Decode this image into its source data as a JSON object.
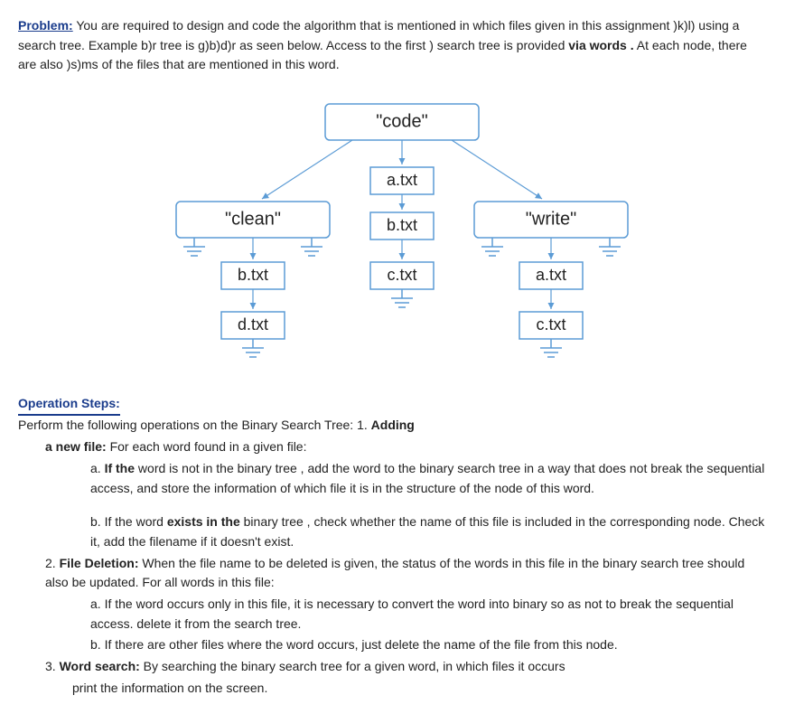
{
  "problem": {
    "heading": "Problem:",
    "text_parts": {
      "p1": " You are required to design and code the algorithm that is mentioned in which files given in this assignment )k)l) using a search tree. Example b)r tree is g)b)d)r as seen below. Access to the first ) search tree is provided ",
      "p2_bold": "via words .",
      "p3": " At each node, there are also )s)ms of the files that are mentioned in this word."
    }
  },
  "tree": {
    "root": "\"code\"",
    "root_files": [
      "a.txt",
      "b.txt",
      "c.txt"
    ],
    "left": "\"clean\"",
    "left_files": [
      "b.txt",
      "d.txt"
    ],
    "right": "\"write\"",
    "right_files": [
      "a.txt",
      "c.txt"
    ]
  },
  "ops": {
    "heading": "Operation Steps:",
    "intro_a": "Perform the following operations on the Binary Search Tree: 1. ",
    "intro_b_bold": "Adding",
    "newfile_a_bold": "a new file:",
    "newfile_b": " For each word found in a given file:",
    "item_a_prefix": "a. ",
    "item_a_bold": "If the",
    "item_a_rest": " word is not in the binary tree , add the word to the binary search tree in a way that does not break the sequential access, and store the information of which file it is in the structure of the node of this word.",
    "item_b_prefix": "b. If the word ",
    "item_b_bold": "exists in the",
    "item_b_rest": " binary tree , check whether the name of this file is included in the corresponding node. Check it, add the filename if it doesn't exist.",
    "step2_prefix": "2. ",
    "step2_bold": "File Deletion:",
    "step2_rest": " When the file name to be deleted is given, the status of the words in this file in the binary search tree should also be updated. For all words in this file:",
    "step2_a": "a. If the word occurs only in this file, it is necessary to convert the word into binary so as not to break the sequential access. delete it from the search tree.",
    "step2_b": "b. If there are other files where the word occurs, just delete the name of the file from this node.",
    "step3_prefix": "3. ",
    "step3_bold": "Word search:",
    "step3_rest": " By searching the binary search tree for a given word, in which files it occurs",
    "step3_tail": "print the information on the screen."
  }
}
